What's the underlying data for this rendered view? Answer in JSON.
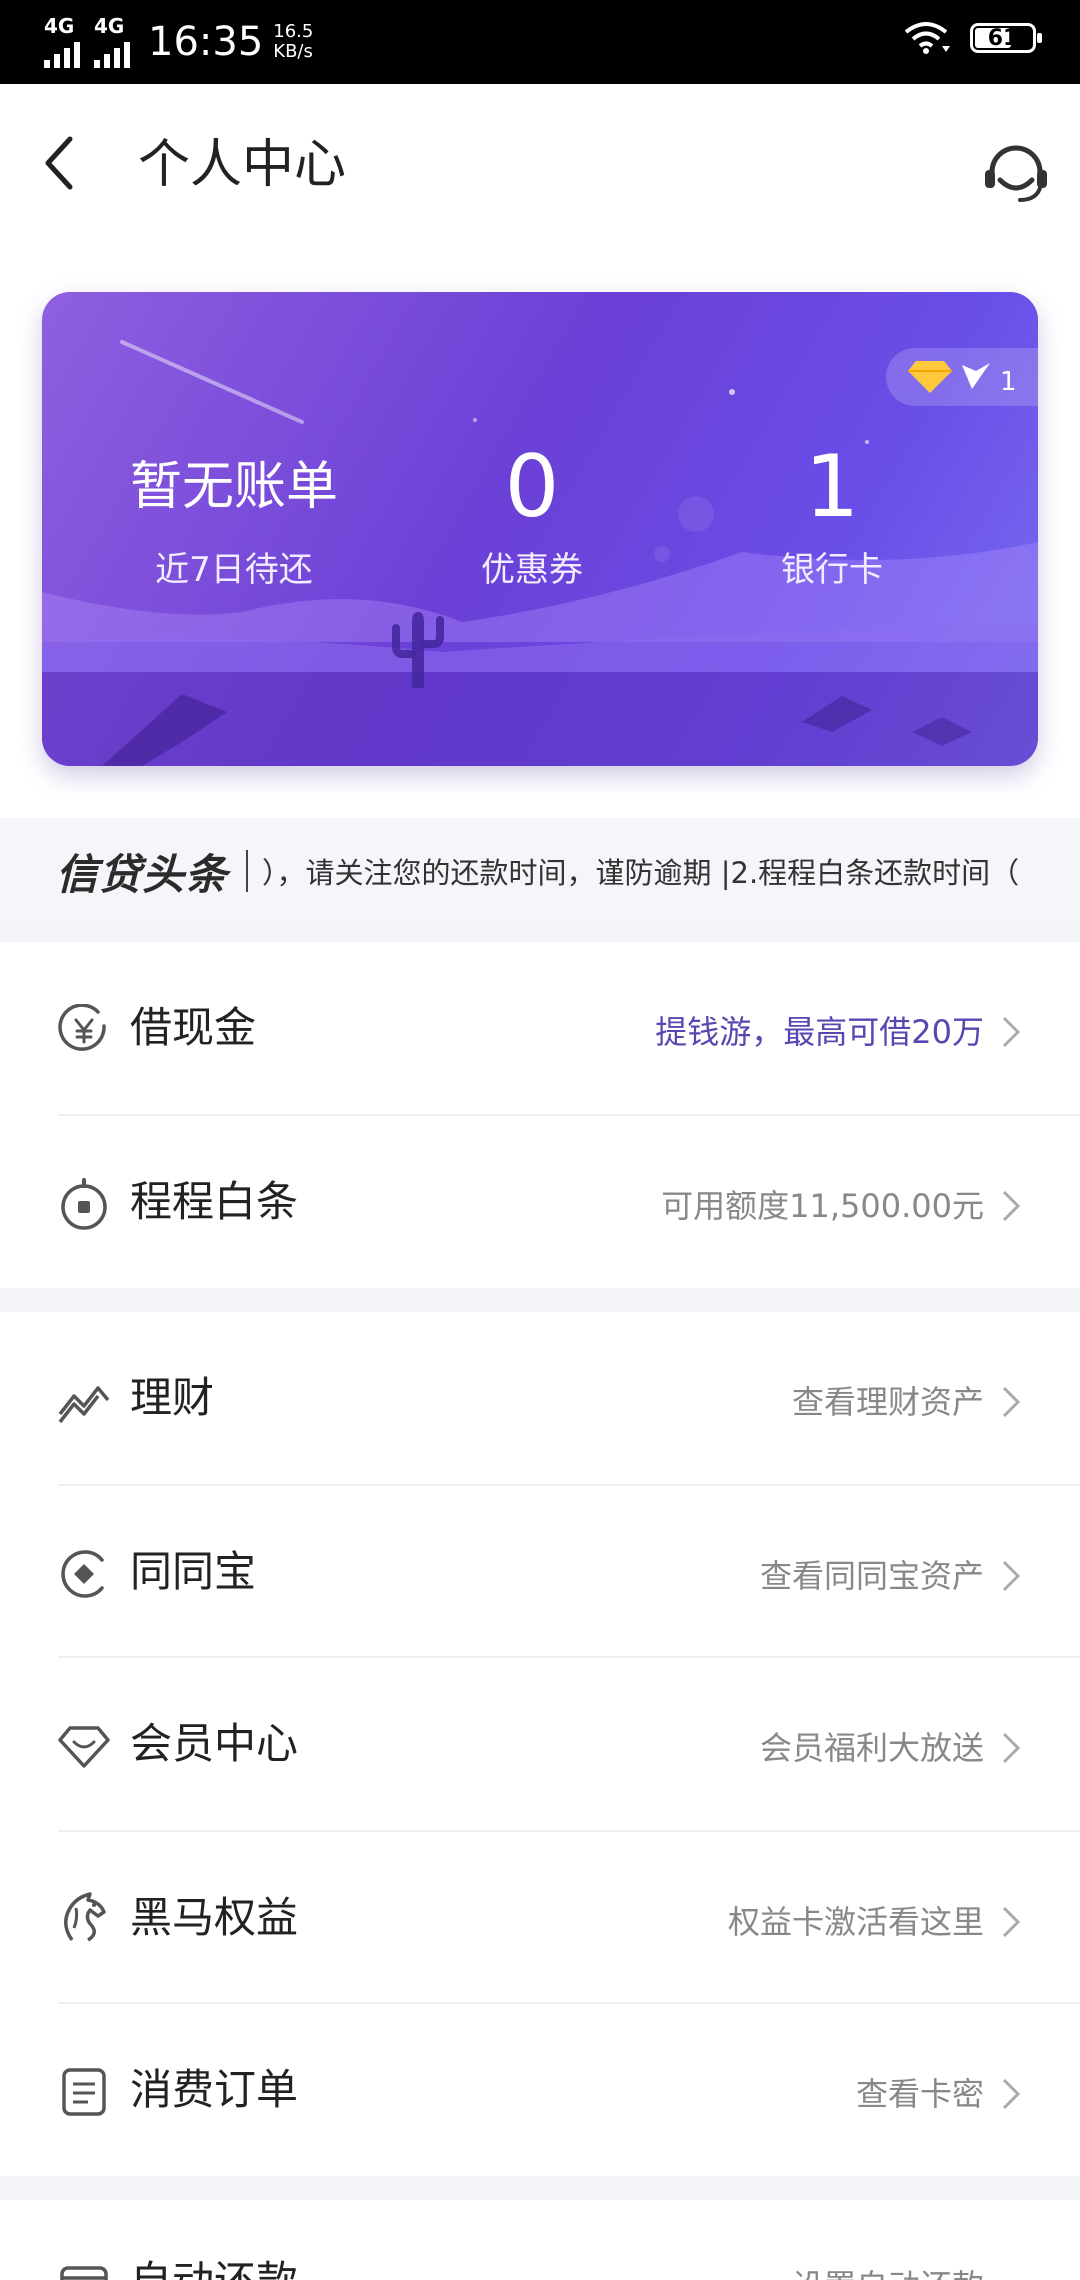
{
  "status_bar": {
    "signal1": "4G",
    "signal2": "4G",
    "time": "16:35",
    "speed_value": "16.5",
    "speed_unit": "KB/s",
    "battery": "61"
  },
  "header": {
    "title": "个人中心",
    "back_icon": "chevron-left-icon",
    "service_icon": "headset-icon"
  },
  "card": {
    "vip_level": "1",
    "stats": [
      {
        "value": "暂无账单",
        "label": "近7日待还"
      },
      {
        "value": "0",
        "label": "优惠券"
      },
      {
        "value": "1",
        "label": "银行卡"
      }
    ],
    "colors": {
      "start": "#8f5fe0",
      "end": "#6a4ee8"
    }
  },
  "news": {
    "brand": "信贷头条",
    "text": "），请关注您的还款时间，谨防逾期 |2.程程白条还款时间（"
  },
  "menu": {
    "group1": [
      {
        "label": "借现金",
        "value": "提钱游，最高可借20万",
        "icon": "yuan-coin-icon",
        "accent": true
      },
      {
        "label": "程程白条",
        "value": "可用额度11,500.00元",
        "icon": "stopwatch-icon",
        "accent": false
      }
    ],
    "group2": [
      {
        "label": "理财",
        "value": "查看理财资产",
        "icon": "trend-chart-icon"
      },
      {
        "label": "同同宝",
        "value": "查看同同宝资产",
        "icon": "tongtongbao-icon"
      },
      {
        "label": "会员中心",
        "value": "会员福利大放送",
        "icon": "diamond-icon"
      },
      {
        "label": "黑马权益",
        "value": "权益卡激活看这里",
        "icon": "horse-icon"
      },
      {
        "label": "消费订单",
        "value": "查看卡密",
        "icon": "order-list-icon"
      }
    ],
    "group3": [
      {
        "label": "自动还款",
        "value": "设置自动还款",
        "icon": "card-icon"
      }
    ]
  },
  "accent_color": "#5b45b0"
}
